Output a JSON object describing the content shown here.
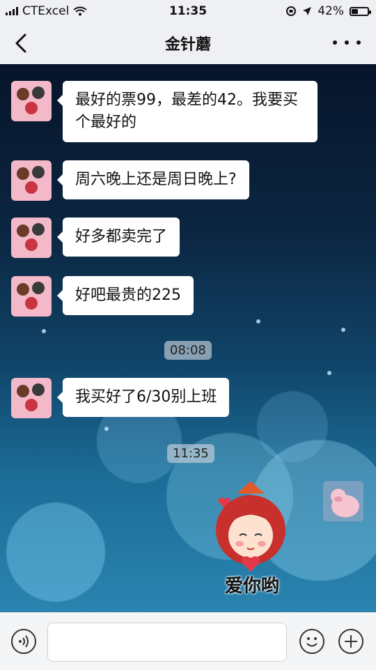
{
  "status": {
    "carrier": "CTExcel",
    "time": "11:35",
    "battery_percent": "42%",
    "battery_level": 0.42
  },
  "header": {
    "title": "金针蘑"
  },
  "messages": [
    {
      "text": "最好的票99，最差的42。我要买个最好的"
    },
    {
      "text": "周六晚上还是周日晚上?"
    },
    {
      "text": "好多都卖完了"
    },
    {
      "text": "好吧最贵的225"
    },
    {
      "text": "我买好了6/30别上班"
    }
  ],
  "timestamps": [
    "08:08",
    "11:35"
  ],
  "sticker": {
    "caption": "爱你哟"
  },
  "input": {
    "placeholder": ""
  },
  "colors": {
    "bubble": "#ffffff",
    "nav_background": "#eef0f3"
  }
}
